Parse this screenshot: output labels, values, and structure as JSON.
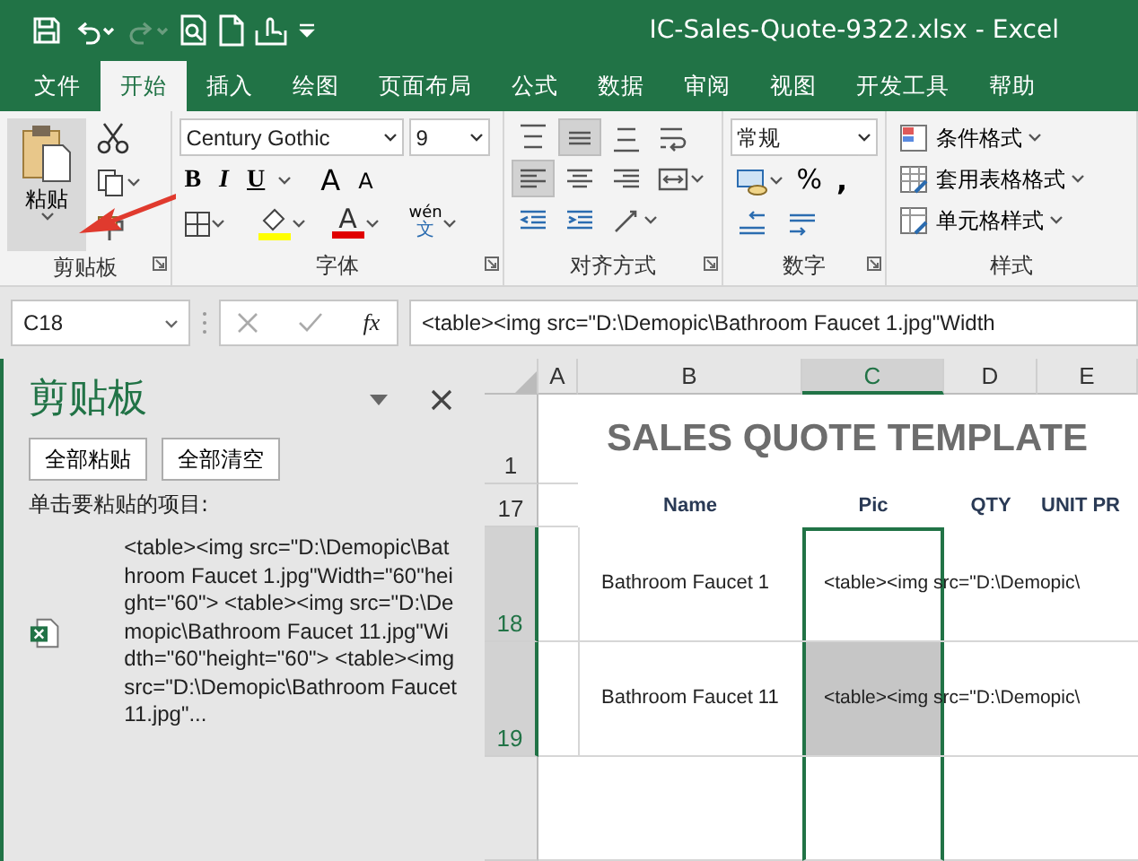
{
  "window": {
    "title": "IC-Sales-Quote-9322.xlsx  -  Excel"
  },
  "quick_access": [
    {
      "kind": "save",
      "disabled": false
    },
    {
      "kind": "undo",
      "disabled": false
    },
    {
      "kind": "redo",
      "disabled": true
    },
    {
      "kind": "print-preview",
      "disabled": false
    },
    {
      "kind": "new",
      "disabled": false
    },
    {
      "kind": "touch",
      "disabled": false
    },
    {
      "kind": "customize",
      "disabled": false
    }
  ],
  "tabs": [
    {
      "label": "文件",
      "selected": false
    },
    {
      "label": "开始",
      "selected": true
    },
    {
      "label": "插入",
      "selected": false
    },
    {
      "label": "绘图",
      "selected": false
    },
    {
      "label": "页面布局",
      "selected": false
    },
    {
      "label": "公式",
      "selected": false
    },
    {
      "label": "数据",
      "selected": false
    },
    {
      "label": "审阅",
      "selected": false
    },
    {
      "label": "视图",
      "selected": false
    },
    {
      "label": "开发工具",
      "selected": false
    },
    {
      "label": "帮助",
      "selected": false
    }
  ],
  "ribbon": {
    "clipboard": {
      "label": "剪贴板",
      "paste_label": "粘贴"
    },
    "font": {
      "label": "字体",
      "font_name": "Century Gothic",
      "font_size": "9",
      "style_buttons": [
        "B",
        "I",
        "U"
      ],
      "size_buttons": [
        "A",
        "A"
      ],
      "font_color_letter": "A",
      "phonetic_top": "wén",
      "phonetic_bottom": "文"
    },
    "alignment": {
      "label": "对齐方式",
      "buttons": [
        {
          "kind": "align-top",
          "pressed": false
        },
        {
          "kind": "align-middle",
          "pressed": true
        },
        {
          "kind": "align-bottom",
          "pressed": false
        },
        {
          "kind": "wrap",
          "pressed": false
        },
        {
          "kind": "align-left",
          "pressed": true
        },
        {
          "kind": "align-center",
          "pressed": false
        },
        {
          "kind": "align-right",
          "pressed": false
        },
        {
          "kind": "merge",
          "pressed": false
        },
        {
          "kind": "indent-decrease",
          "pressed": false
        },
        {
          "kind": "indent-increase",
          "pressed": false
        },
        {
          "kind": "orientation",
          "pressed": false
        }
      ]
    },
    "number": {
      "label": "数字",
      "format": "常规",
      "percent": "%",
      "comma": ","
    },
    "styles": {
      "label": "样式",
      "items": [
        "条件格式",
        "套用表格格式",
        "单元格样式"
      ]
    }
  },
  "name_box": "C18",
  "function_label": "fx",
  "formula": "<table><img src=\"D:\\Demopic\\Bathroom Faucet 1.jpg\"Width",
  "clipboard_pane": {
    "title": "剪贴板",
    "buttons": [
      "全部粘贴",
      "全部清空"
    ],
    "hint": "单击要粘贴的项目:",
    "items": [
      {
        "text": "<table><img src=\"D:\\Demopic\\Bathroom Faucet 1.jpg\"Width=\"60\"height=\"60\"> <table><img src=\"D:\\Demopic\\Bathroom Faucet 11.jpg\"Width=\"60\"height=\"60\"> <table><img src=\"D:\\Demopic\\Bathroom Faucet 11.jpg\"..."
      }
    ]
  },
  "sheet": {
    "columns": [
      {
        "label": "A",
        "selected": false
      },
      {
        "label": "B",
        "selected": false
      },
      {
        "label": "C",
        "selected": true
      },
      {
        "label": "D",
        "selected": false
      },
      {
        "label": "E",
        "selected": false
      }
    ],
    "title": "SALES QUOTE TEMPLATE",
    "title_row": "1",
    "header_row": "17",
    "headers": [
      "Name",
      "Pic",
      "QTY",
      "UNIT PR"
    ],
    "rows": [
      {
        "number": "18",
        "name": "Bathroom Faucet 1",
        "pic": "<table><img src=\"D:\\Demopic\\",
        "selected": true,
        "active": true
      },
      {
        "number": "19",
        "name": "Bathroom Faucet 11",
        "pic": "<table><img src=\"D:\\Demopic\\",
        "selected": true,
        "active": false
      }
    ]
  }
}
